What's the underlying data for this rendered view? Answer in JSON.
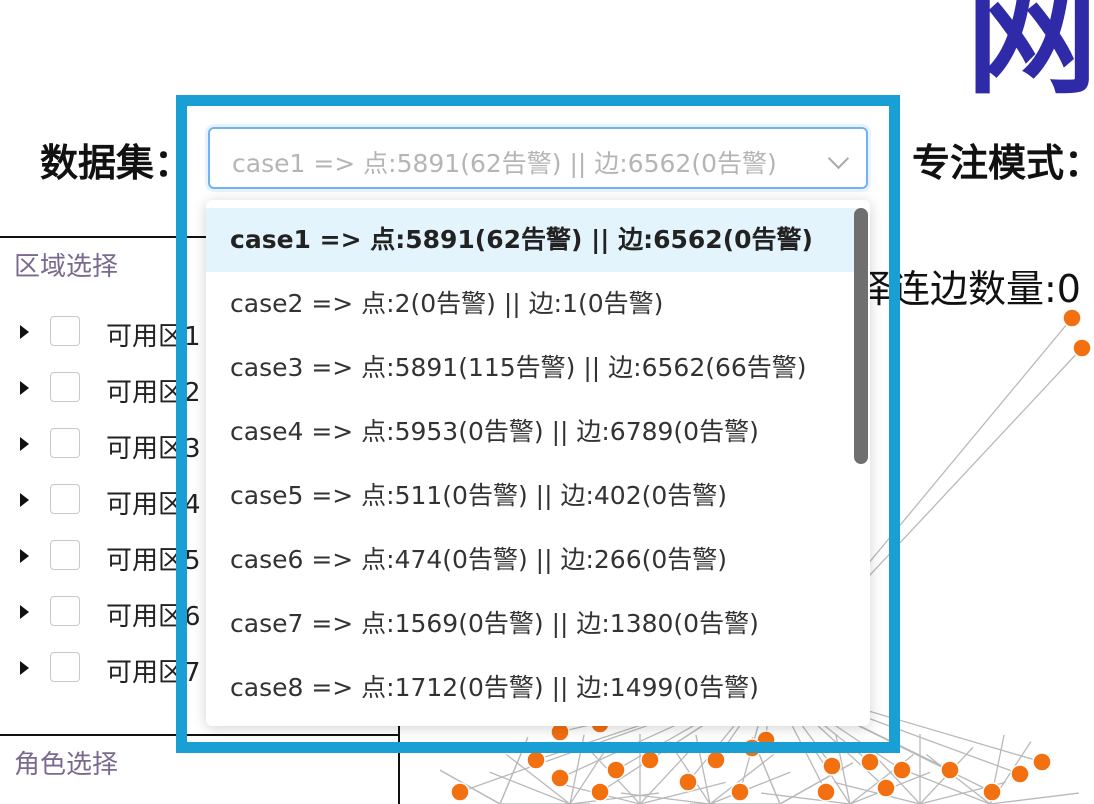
{
  "header": {
    "title": "网络",
    "dataset_label": "数据集：",
    "focus_label": "专注模式："
  },
  "dataset_select": {
    "value": "case1 => 点:5891(62告警) || 边:6562(0告警)",
    "options": [
      {
        "label": "case1 => 点:5891(62告警) || 边:6562(0告警)",
        "selected": true
      },
      {
        "label": "case2 => 点:2(0告警) || 边:1(0告警)",
        "selected": false
      },
      {
        "label": "case3 => 点:5891(115告警) || 边:6562(66告警)",
        "selected": false
      },
      {
        "label": "case4 => 点:5953(0告警) || 边:6789(0告警)",
        "selected": false
      },
      {
        "label": "case5 => 点:511(0告警) || 边:402(0告警)",
        "selected": false
      },
      {
        "label": "case6 => 点:474(0告警) || 边:266(0告警)",
        "selected": false
      },
      {
        "label": "case7 => 点:1569(0告警) || 边:1380(0告警)",
        "selected": false
      },
      {
        "label": "case8 => 点:1712(0告警) || 边:1499(0告警)",
        "selected": false
      }
    ]
  },
  "region_panel": {
    "title": "区域选择",
    "items": [
      {
        "label": "可用区1"
      },
      {
        "label": "可用区2"
      },
      {
        "label": "可用区3"
      },
      {
        "label": "可用区4"
      },
      {
        "label": "可用区5"
      },
      {
        "label": "可用区6"
      },
      {
        "label": "可用区7"
      }
    ]
  },
  "role_panel": {
    "title": "角色选择"
  },
  "stats": {
    "edge_count_text": "择连边数量:0"
  },
  "colors": {
    "highlight_frame": "#1a9fd4",
    "title": "#2e2aa8",
    "node": "#f2700f",
    "selected_option_bg": "#e4f4fc"
  }
}
